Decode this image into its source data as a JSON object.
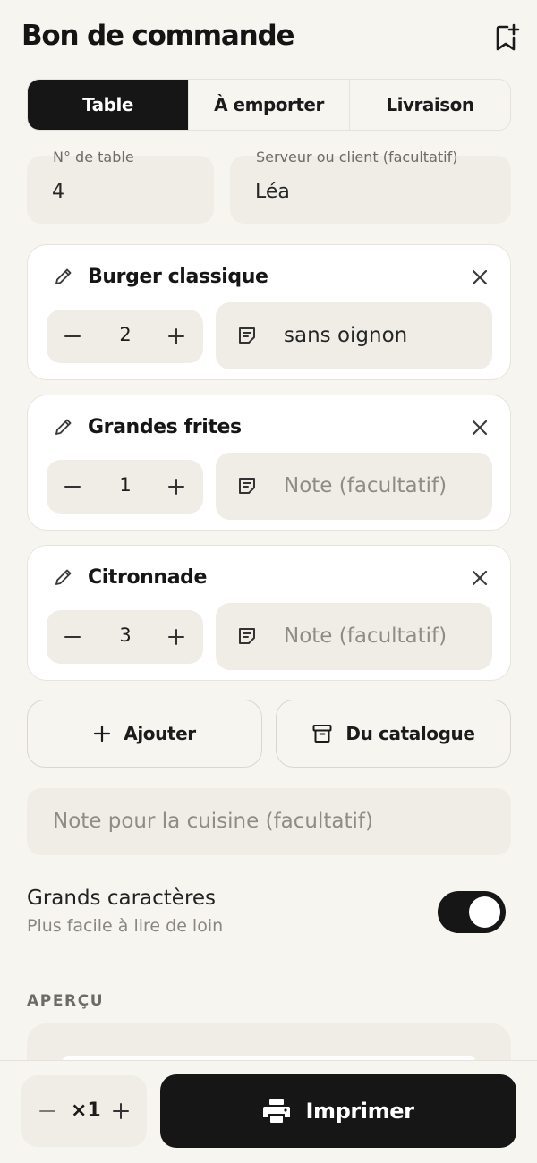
{
  "header": {
    "title": "Bon de commande",
    "bookmark_icon": "bookmark-add-icon"
  },
  "order_type_tabs": [
    {
      "label": "Table",
      "active": true
    },
    {
      "label": "À emporter",
      "active": false
    },
    {
      "label": "Livraison",
      "active": false
    }
  ],
  "fields": {
    "table_number": {
      "label": "N° de table",
      "value": "4"
    },
    "server_or_client": {
      "label": "Serveur ou client (facultatif)",
      "value": "Léa"
    }
  },
  "items": [
    {
      "name": "Burger classique",
      "quantity": "2",
      "note": "sans oignon",
      "note_placeholder": "Note (facultatif)"
    },
    {
      "name": "Grandes frites",
      "quantity": "1",
      "note": "",
      "note_placeholder": "Note (facultatif)"
    },
    {
      "name": "Citronnade",
      "quantity": "3",
      "note": "",
      "note_placeholder": "Note (facultatif)"
    }
  ],
  "actions": {
    "add_label": "Ajouter",
    "catalog_label": "Du catalogue"
  },
  "kitchen_note": {
    "placeholder": "Note pour la cuisine (facultatif)"
  },
  "large_text": {
    "title": "Grands caractères",
    "subtitle": "Plus facile à lire de loin",
    "enabled": true
  },
  "preview": {
    "label": "APERÇU"
  },
  "footer": {
    "copies": "×1",
    "print_label": "Imprimer"
  },
  "colors": {
    "accent": "#161616",
    "background": "#f6f5f0",
    "field": "#efede6"
  }
}
